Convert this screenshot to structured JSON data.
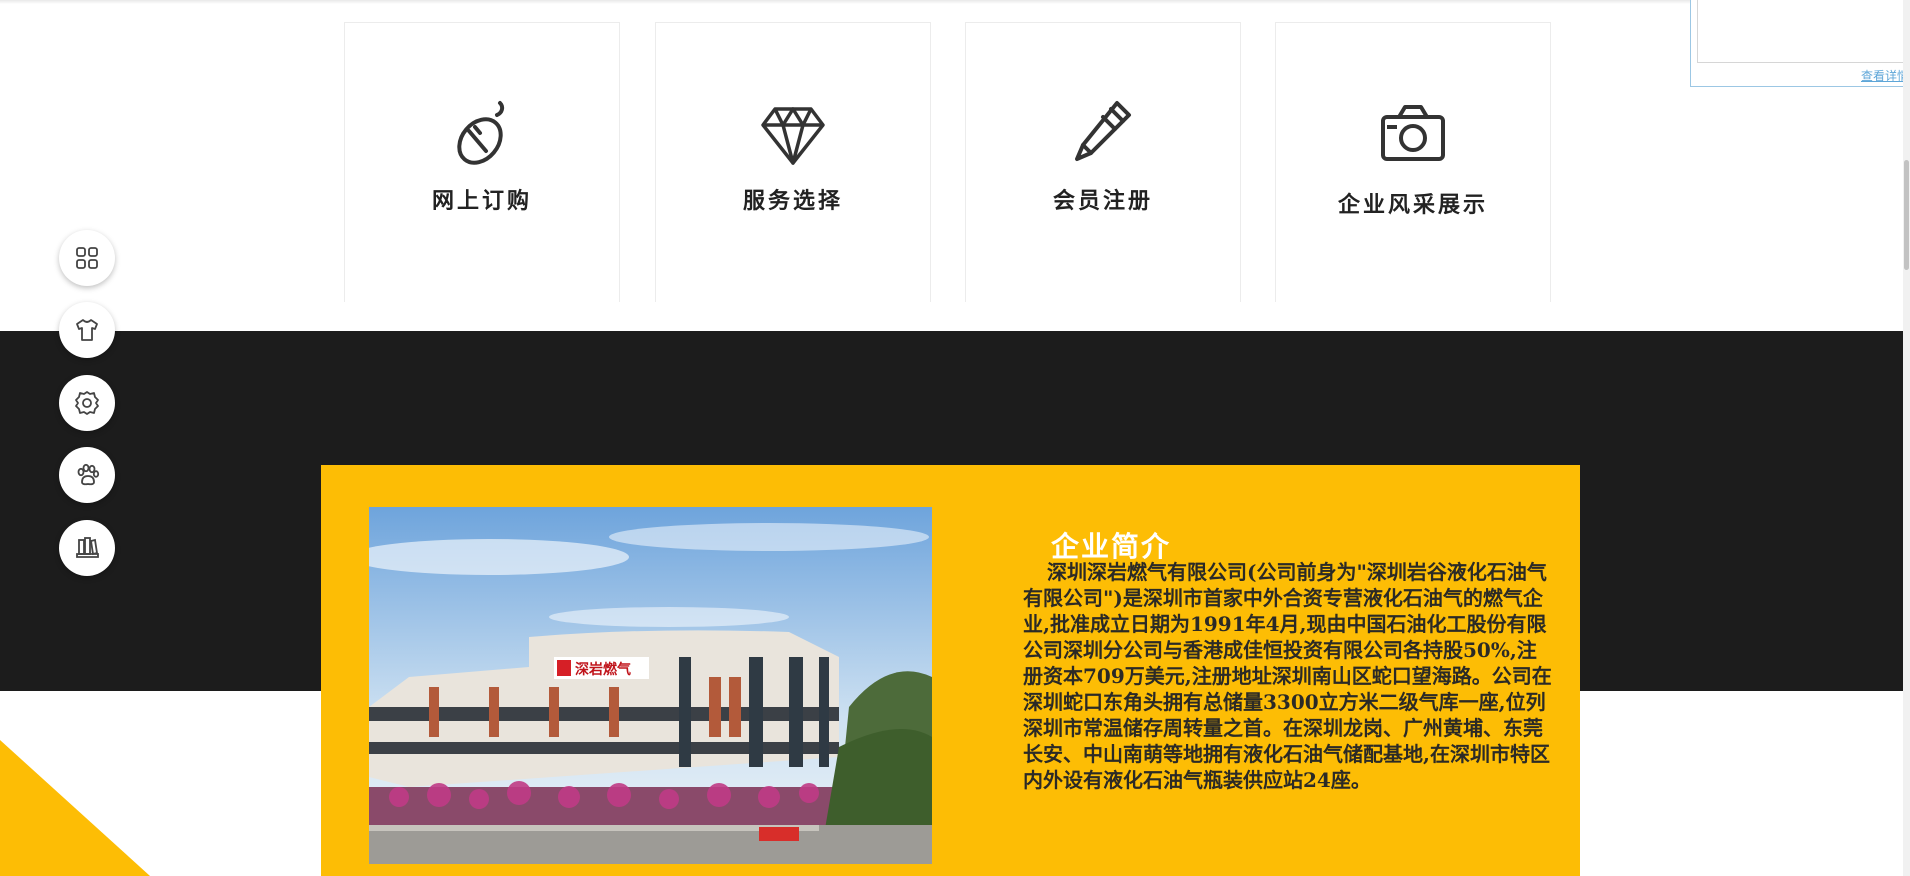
{
  "cards": [
    {
      "label": "网上订购",
      "icon": "mouse-icon"
    },
    {
      "label": "服务选择",
      "icon": "diamond-icon"
    },
    {
      "label": "会员注册",
      "icon": "pencil-icon"
    },
    {
      "label": "企业风采展示",
      "icon": "camera-icon"
    }
  ],
  "intro": {
    "title": "企业简介",
    "body": "深圳深岩燃气有限公司(公司前身为\"深圳岩谷液化石油气有限公司\")是深圳市首家中外合资专营液化石油气的燃气企业,批准成立日期为1991年4月,现由中国石油化工股份有限公司深圳分公司与香港成佳恒投资有限公司各持股50%,注册资本709万美元,注册地址深圳南山区蛇口望海路。公司在深圳蛇口东角头拥有总储量3300立方米二级气库一座,位列深圳市常温储存周转量之首。在深圳龙岗、广州黄埔、东莞长安、中山南萌等地拥有液化石油气储配基地,在深圳市特区内外设有液化石油气瓶装供应站24座。",
    "photo_sign": "深岩燃气"
  },
  "side_buttons": [
    "apps-icon",
    "shirt-icon",
    "settings-icon",
    "paw-icon",
    "books-icon"
  ],
  "popup": {
    "link_text": "查看详情"
  },
  "colors": {
    "accent": "#fdbd05",
    "dark": "#1c1c1c",
    "text": "#222222",
    "link": "#5ea6d8"
  }
}
